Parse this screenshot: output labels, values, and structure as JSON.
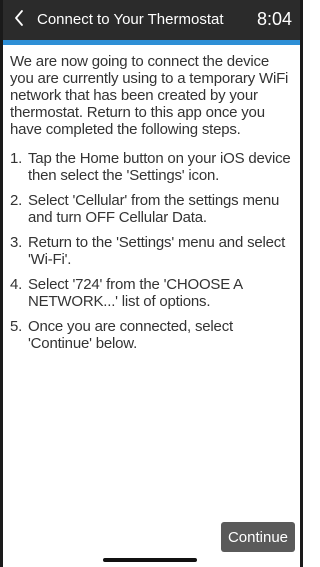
{
  "header": {
    "back_icon": "chevron-left-icon",
    "title": "Connect to Your Thermostat",
    "time": "8:04",
    "background_color": "#2b2b2b",
    "accent_color": "#2e8fd6"
  },
  "main": {
    "intro": "We are now going to connect the device you are currently using to a temporary WiFi network that has been created by your thermostat. Return to this app once you have completed the following steps.",
    "steps": [
      {
        "num": "1.",
        "text": "Tap the Home button on your iOS device then select the 'Settings' icon."
      },
      {
        "num": "2.",
        "text": "Select 'Cellular' from the settings menu and turn OFF Cellular Data."
      },
      {
        "num": "3.",
        "text": "Return to the 'Settings' menu and select 'Wi-Fi'."
      },
      {
        "num": "4.",
        "text": "Select '724' from the 'CHOOSE A NETWORK...' list of options."
      },
      {
        "num": "5.",
        "text": "Once you are connected, select 'Continue' below."
      }
    ]
  },
  "footer": {
    "continue_label": "Continue",
    "button_color": "#5a5a5a"
  }
}
